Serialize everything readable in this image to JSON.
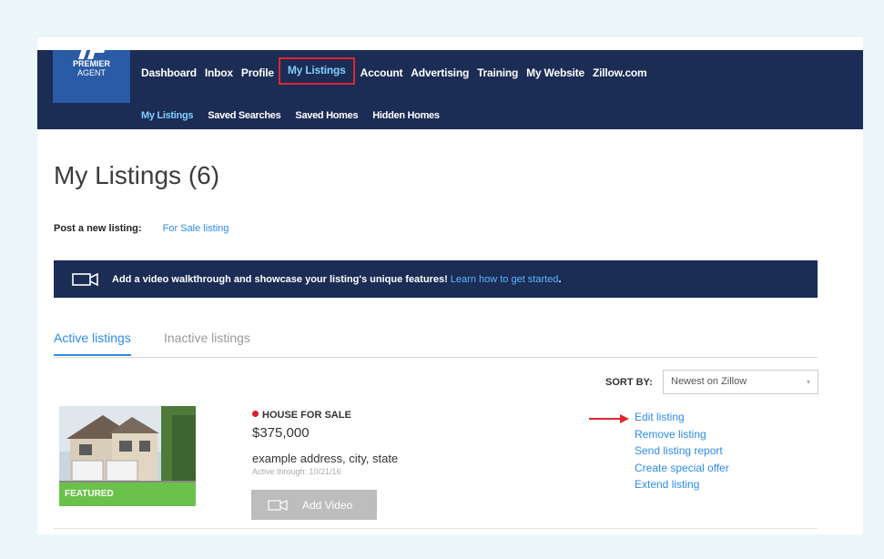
{
  "brand": {
    "line1": "PREMIER",
    "line2": "AGENT",
    "color": "#2a5ba6"
  },
  "nav": {
    "items": [
      "Dashboard",
      "Inbox",
      "Profile",
      "My Listings",
      "Account",
      "Advertising",
      "Training",
      "My Website",
      "Zillow.com"
    ],
    "active": "My Listings"
  },
  "subnav": {
    "items": [
      "My Listings",
      "Saved Searches",
      "Saved Homes",
      "Hidden Homes"
    ],
    "active": "My Listings"
  },
  "page": {
    "title": "My Listings (6)"
  },
  "post": {
    "label": "Post a new listing:",
    "link": "For Sale listing"
  },
  "banner": {
    "text": "Add a video walkthrough and showcase your listing's unique features!",
    "link": "Learn how to get started",
    "end": "."
  },
  "tabs": {
    "active": "Active listings",
    "inactive": "Inactive listings"
  },
  "sort": {
    "label": "SORT BY:",
    "value": "Newest on Zillow"
  },
  "listing": {
    "badge": "FEATURED",
    "status": "HOUSE FOR SALE",
    "price": "$375,000",
    "address": "example address, city, state",
    "active_through": "Active through: 10/21/16",
    "add_video": "Add Video",
    "actions": [
      "Edit listing",
      "Remove listing",
      "Send listing report",
      "Create special offer",
      "Extend listing"
    ]
  },
  "colors": {
    "navy": "#1b2c55",
    "link": "#2d8ce6",
    "highlight": "#e0262e",
    "featured": "#6ac24a"
  }
}
